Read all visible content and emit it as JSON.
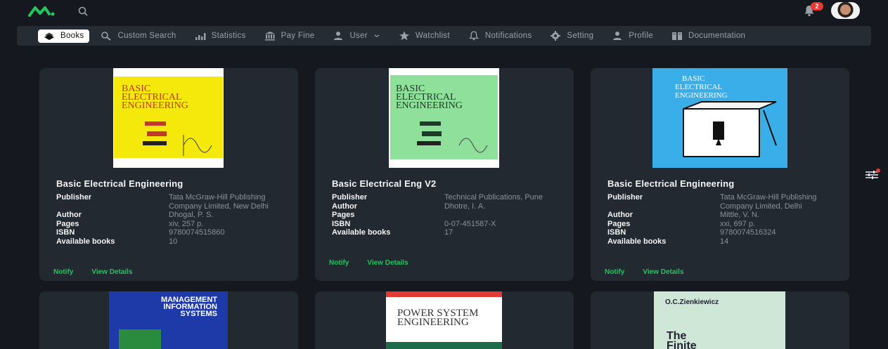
{
  "notifications": {
    "count": "2"
  },
  "nav": [
    {
      "label": "Books",
      "icon": "books-icon",
      "active": true
    },
    {
      "label": "Custom Search",
      "icon": "search-icon"
    },
    {
      "label": "Statistics",
      "icon": "bar-chart-icon"
    },
    {
      "label": "Pay Fine",
      "icon": "bank-icon"
    },
    {
      "label": "User",
      "icon": "user-icon"
    },
    {
      "label": "Watchlist",
      "icon": "star-icon"
    },
    {
      "label": "Notifications",
      "icon": "bell-icon"
    },
    {
      "label": "Setting",
      "icon": "gear-icon"
    },
    {
      "label": "Profile",
      "icon": "user-icon"
    },
    {
      "label": "Documentation",
      "icon": "document-icon"
    }
  ],
  "meta_labels": {
    "publisher": "Publisher",
    "author": "Author",
    "pages": "Pages",
    "isbn": "ISBN",
    "available": "Available books"
  },
  "actions": {
    "notify": "Notify",
    "details": "View Details"
  },
  "books": [
    {
      "title": "Basic Electrical Engineering",
      "publisher": "Tata McGraw-Hill Publishing Company Limited, New Delhi",
      "author": "Dhogal, P. S.",
      "pages": "xiv, 257 p.",
      "isbn": "9780074515860",
      "available": "10",
      "cover_lines": [
        "BASIC",
        "ELECTRICAL",
        "ENGINEERING"
      ],
      "cover_color": "#f5e90c"
    },
    {
      "title": "Basic Electrical Eng V2",
      "publisher": "Technical Publications, Pune",
      "author": "Dhotre, I. A.",
      "pages": "",
      "isbn": "0-07-451587-X",
      "available": "17",
      "cover_lines": [
        "BASIC",
        "ELECTRICAL",
        "ENGINEERING"
      ],
      "cover_color": "#8fe09a"
    },
    {
      "title": "Basic Electrical Engineering",
      "publisher": "Tata McGraw-Hill Publishing Company Limited, Delhi",
      "author": "Mittle, V. N.",
      "pages": "xxi, 697 p.",
      "isbn": "9780074516324",
      "available": "14",
      "cover_lines": [
        "BASIC",
        "ELECTRICAL",
        "ENGINEERING"
      ],
      "cover_color": "#3aaee8"
    },
    {
      "cover_lines": [
        "MANAGEMENT",
        "INFORMATION",
        "SYSTEMS"
      ],
      "cover_color": "#1d3aa8"
    },
    {
      "cover_lines": [
        "POWER SYSTEM",
        "ENGINEERING"
      ],
      "cover_color": "#ffffff"
    },
    {
      "cover_lines": [
        "O.C.Zienkiewicz",
        "The",
        "Finite"
      ],
      "cover_color": "#cfe7d6"
    }
  ]
}
